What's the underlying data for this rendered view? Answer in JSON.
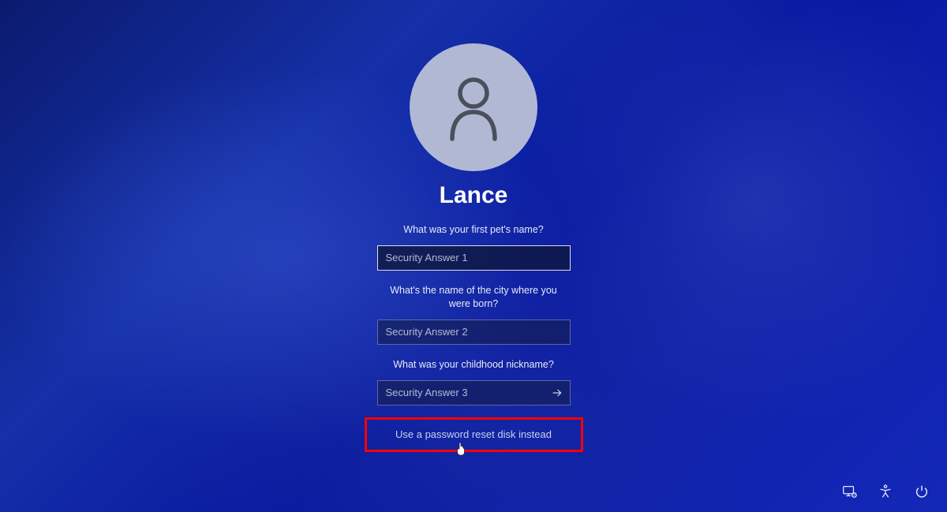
{
  "user": {
    "name": "Lance"
  },
  "security": {
    "q1": "What was your first pet's name?",
    "p1": "Security Answer 1",
    "q2": "What's the name of the city where you were born?",
    "p2": "Security Answer 2",
    "q3": "What was your childhood nickname?",
    "p3": "Security Answer 3"
  },
  "link": {
    "reset_disk": "Use a password reset disk instead"
  }
}
